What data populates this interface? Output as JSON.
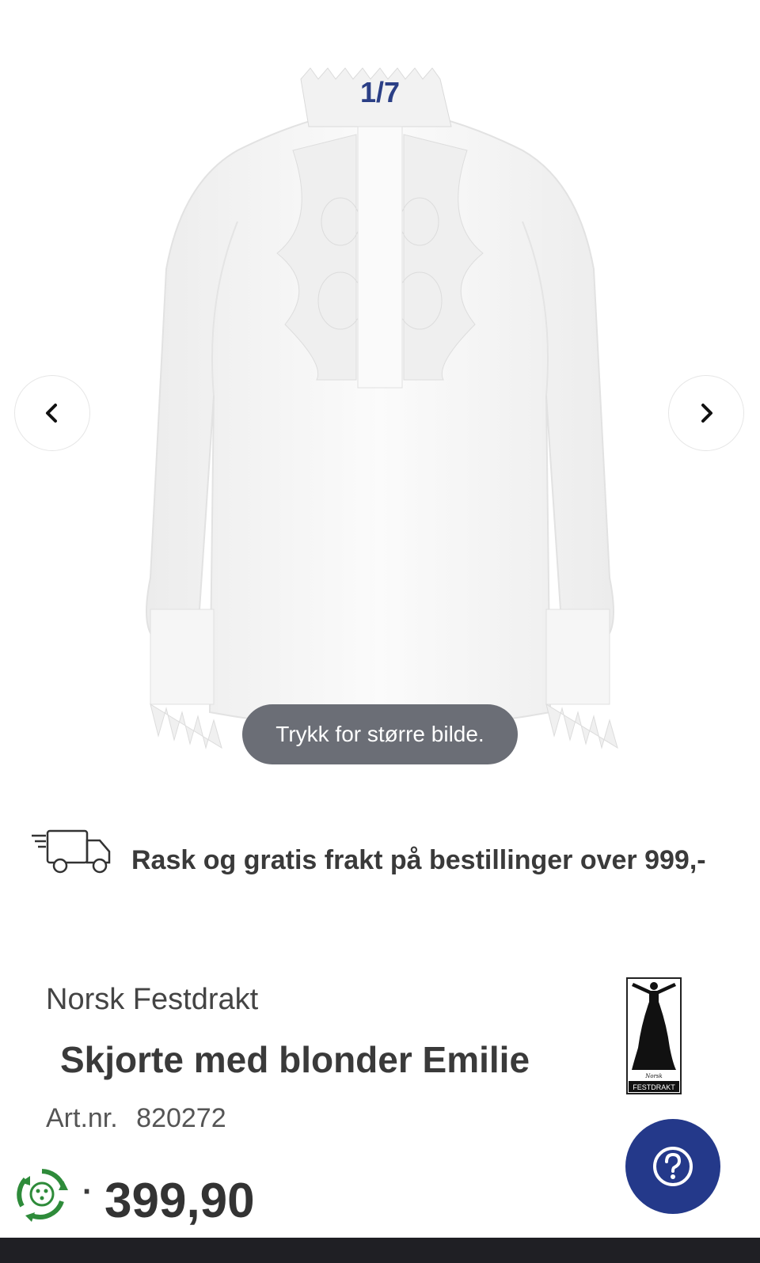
{
  "gallery": {
    "counter": "1/7",
    "zoom_hint": "Trykk for større bilde.",
    "prev_icon": "chevron-left-icon",
    "next_icon": "chevron-right-icon",
    "image_alt": "Skjorte med blonder Emilie"
  },
  "shipping": {
    "icon": "delivery-truck-icon",
    "text": "Rask og gratis frakt på bestillinger over 999,-"
  },
  "product": {
    "brand": "Norsk Festdrakt",
    "title": "Skjorte med blonder Emilie",
    "artnr_label": "Art.nr.",
    "artnr": "820272",
    "price_separator": "·",
    "price": "399,90",
    "logo_text": "FESTDRAKT",
    "logo_script": "Norsk"
  },
  "help": {
    "icon": "question-icon"
  },
  "colors": {
    "accent": "#2b3f86",
    "help_button": "#24398a",
    "zoom_pill": "#6b6e76",
    "bottom_bar": "#1f1f24",
    "eco_green": "#2e8b3a"
  }
}
